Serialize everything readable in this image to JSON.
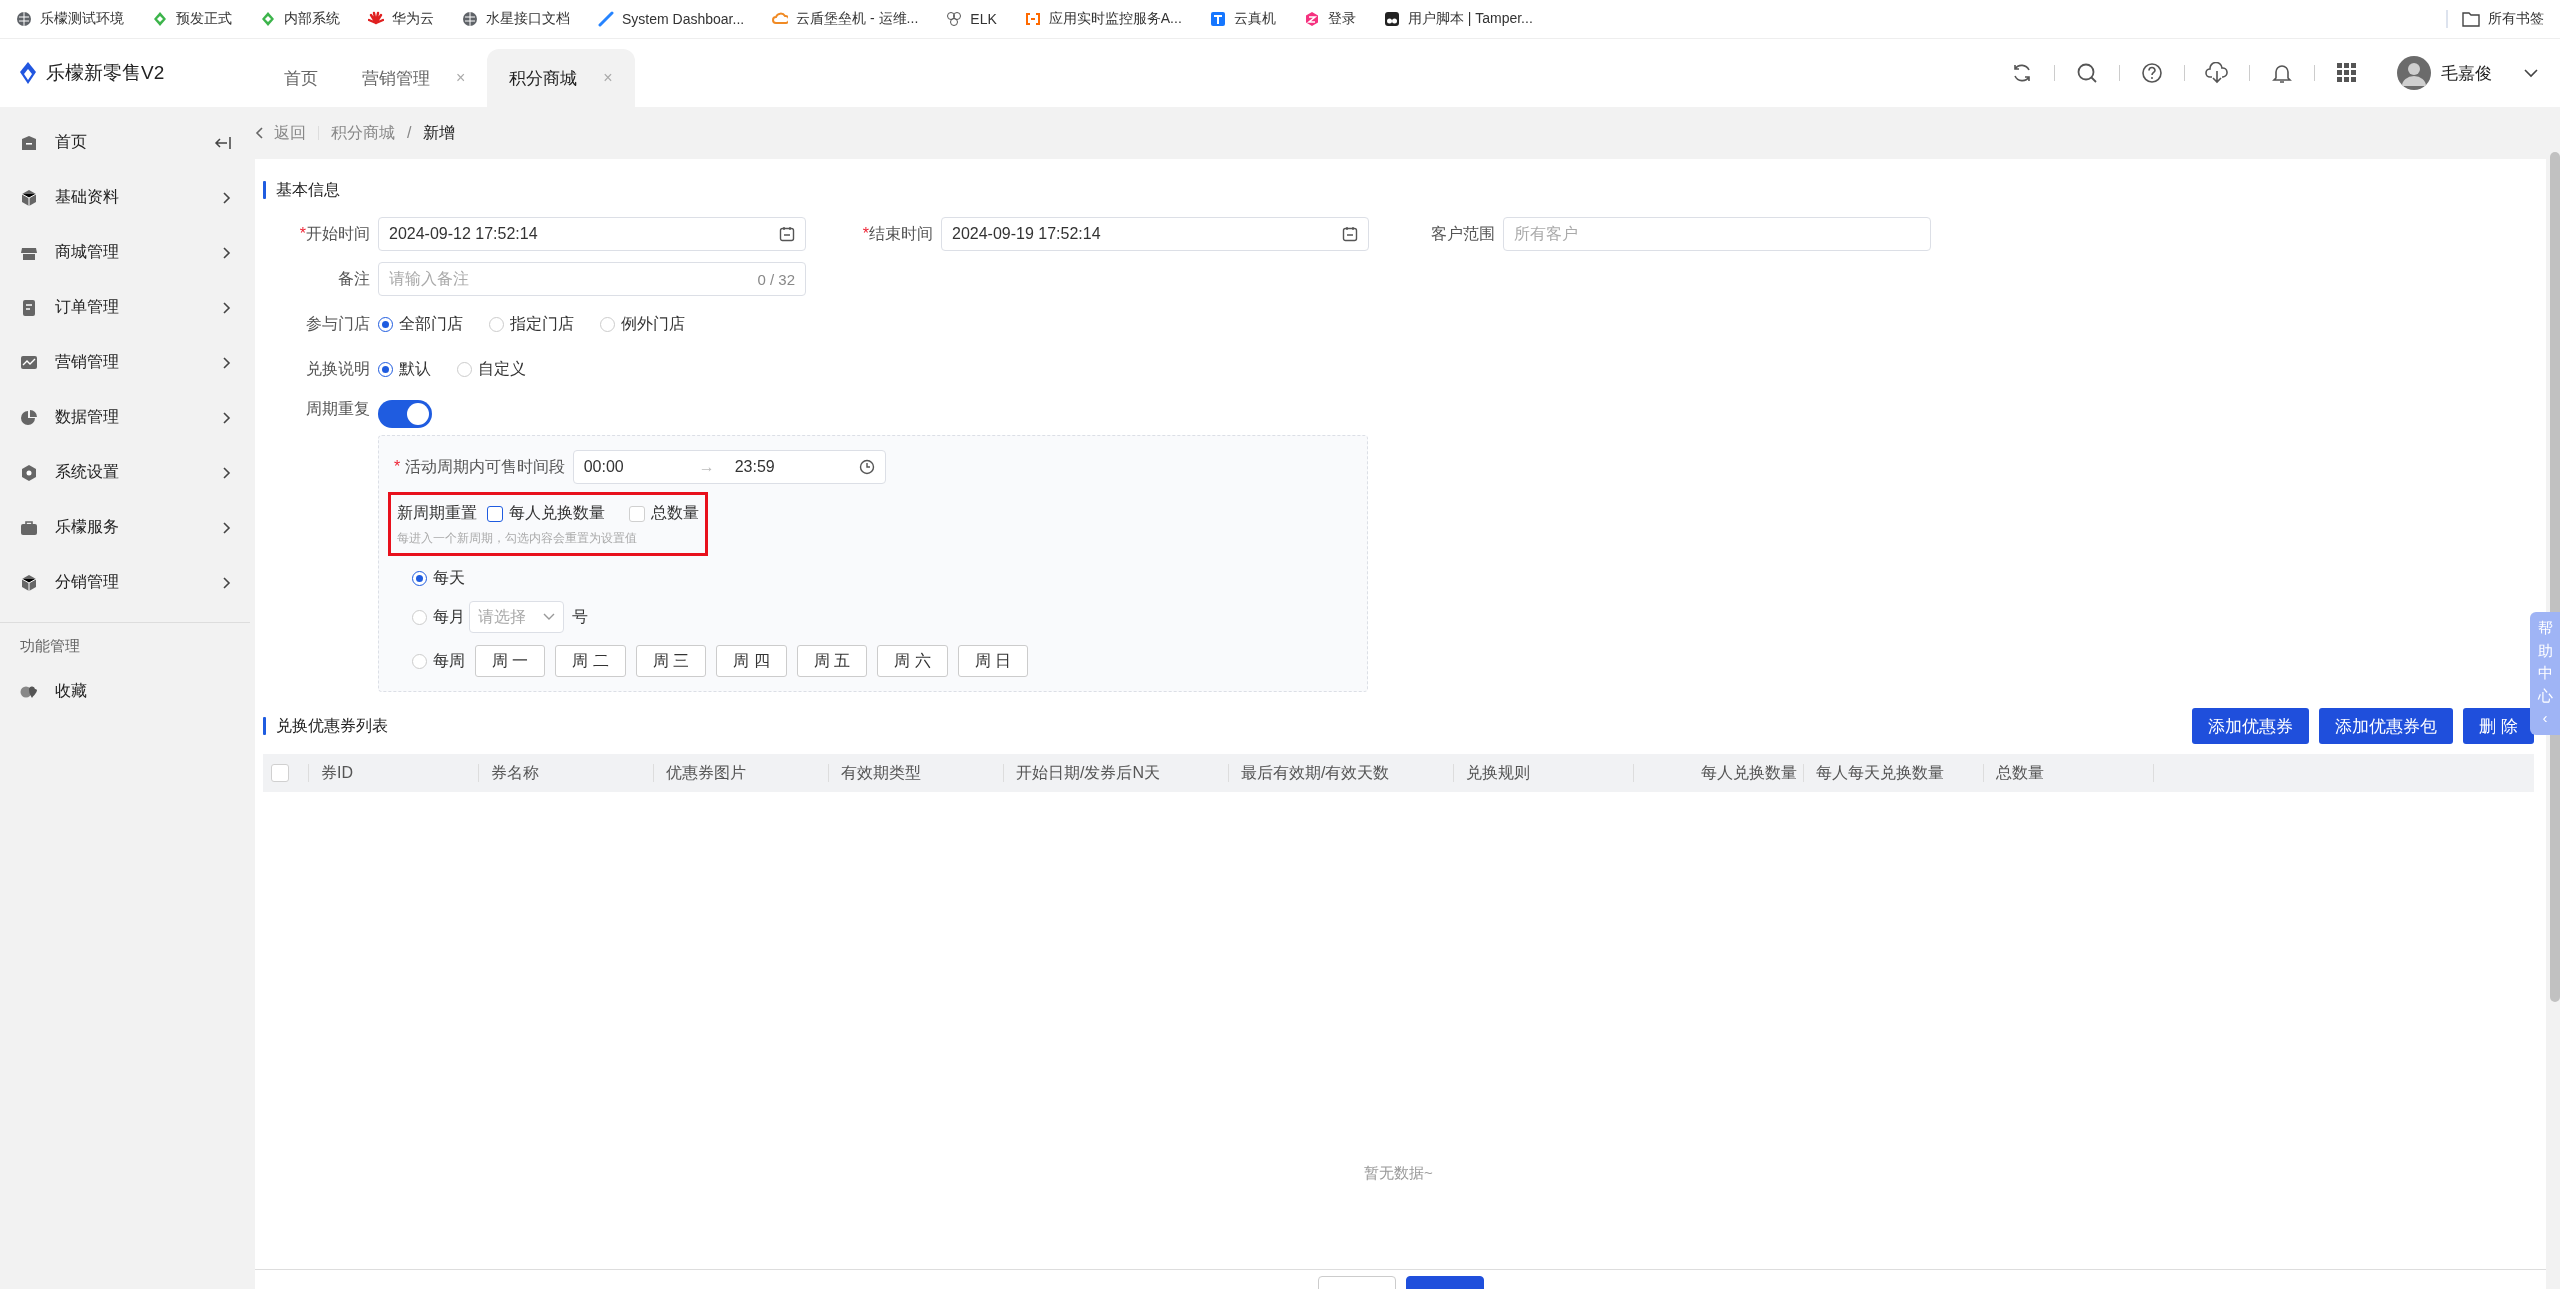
{
  "bookmarks": [
    {
      "label": "乐檬测试环境"
    },
    {
      "label": "预发正式"
    },
    {
      "label": "内部系统"
    },
    {
      "label": "华为云"
    },
    {
      "label": "水星接口文档"
    },
    {
      "label": "System Dashboar..."
    },
    {
      "label": "云盾堡垒机 - 运维..."
    },
    {
      "label": "ELK"
    },
    {
      "label": "应用实时监控服务A..."
    },
    {
      "label": "云真机"
    },
    {
      "label": "登录"
    },
    {
      "label": "用户脚本 | Tamper..."
    }
  ],
  "all_bookmarks": "所有书签",
  "app": {
    "logo": "乐檬新零售V2",
    "user": "毛嘉俊"
  },
  "tabs": [
    {
      "label": "首页",
      "selected": false
    },
    {
      "label": "营销管理",
      "selected": false,
      "close": "×"
    },
    {
      "label": "积分商城",
      "selected": true,
      "close": "×"
    }
  ],
  "sidebar": {
    "items": [
      {
        "label": "首页",
        "kind": "collapse"
      },
      {
        "label": "基础资料",
        "kind": "menu"
      },
      {
        "label": "商城管理",
        "kind": "menu"
      },
      {
        "label": "订单管理",
        "kind": "menu"
      },
      {
        "label": "营销管理",
        "kind": "menu"
      },
      {
        "label": "数据管理",
        "kind": "menu"
      },
      {
        "label": "系统设置",
        "kind": "menu"
      },
      {
        "label": "乐檬服务",
        "kind": "menu"
      },
      {
        "label": "分销管理",
        "kind": "menu"
      }
    ],
    "section": "功能管理",
    "favorites": [
      {
        "label": "收藏"
      }
    ]
  },
  "breadcrumb": {
    "back": "返回",
    "items": [
      "积分商城",
      "新增"
    ],
    "separator": "/"
  },
  "basic": {
    "title": "基本信息",
    "start": {
      "mark": "*",
      "label": "开始时间",
      "value": "2024-09-12 17:52:14"
    },
    "end": {
      "mark": "*",
      "label": "结束时间",
      "value": "2024-09-19 17:52:14"
    },
    "customers": {
      "label": "客户范围",
      "placeholder": "所有客户"
    },
    "note": {
      "label": "备注",
      "placeholder": "请输入备注",
      "counter": "0 / 32"
    },
    "stores": {
      "label": "参与门店",
      "options": [
        {
          "label": "全部门店",
          "selected": true
        },
        {
          "label": "指定门店",
          "selected": false
        },
        {
          "label": "例外门店",
          "selected": false
        }
      ]
    },
    "description": {
      "label": "兑换说明",
      "options": [
        {
          "label": "默认",
          "selected": true
        },
        {
          "label": "自定义",
          "selected": false
        }
      ]
    },
    "repeat": {
      "label": "周期重复",
      "on": true
    },
    "period": {
      "mark": "*",
      "label": "活动周期内可售时间段",
      "from": "00:00",
      "separator": "→",
      "to": "23:59",
      "reset": {
        "label": "新周期重置",
        "options": [
          {
            "label": "每人兑换数量",
            "checked": false,
            "focused": true
          },
          {
            "label": "总数量",
            "checked": false,
            "focused": false
          }
        ],
        "hint": "每进入一个新周期，勾选内容会重置为设置值",
        "highlighted": true
      },
      "daily": {
        "label": "每天",
        "selected": true
      },
      "monthly": {
        "label": "每月",
        "selected": false,
        "placeholder": "请选择",
        "suffix": "号"
      },
      "weekly": {
        "label": "每周",
        "selected": false,
        "days": [
          "周 一",
          "周 二",
          "周 三",
          "周 四",
          "周 五",
          "周 六",
          "周 日"
        ]
      }
    }
  },
  "coupons": {
    "title": "兑换优惠券列表",
    "buttons": [
      "添加优惠券",
      "添加优惠券包",
      "删 除"
    ],
    "select_all": {
      "checked": false
    },
    "columns": [
      "券ID",
      "券名称",
      "优惠券图片",
      "有效期类型",
      "开始日期/发券后N天",
      "最后有效期/有效天数",
      "兑换规则",
      "每人兑换数量",
      "每人每天兑换数量",
      "总数量"
    ],
    "empty": "暂无数据~"
  },
  "help": [
    "帮",
    "助",
    "中",
    "心",
    "‹"
  ]
}
